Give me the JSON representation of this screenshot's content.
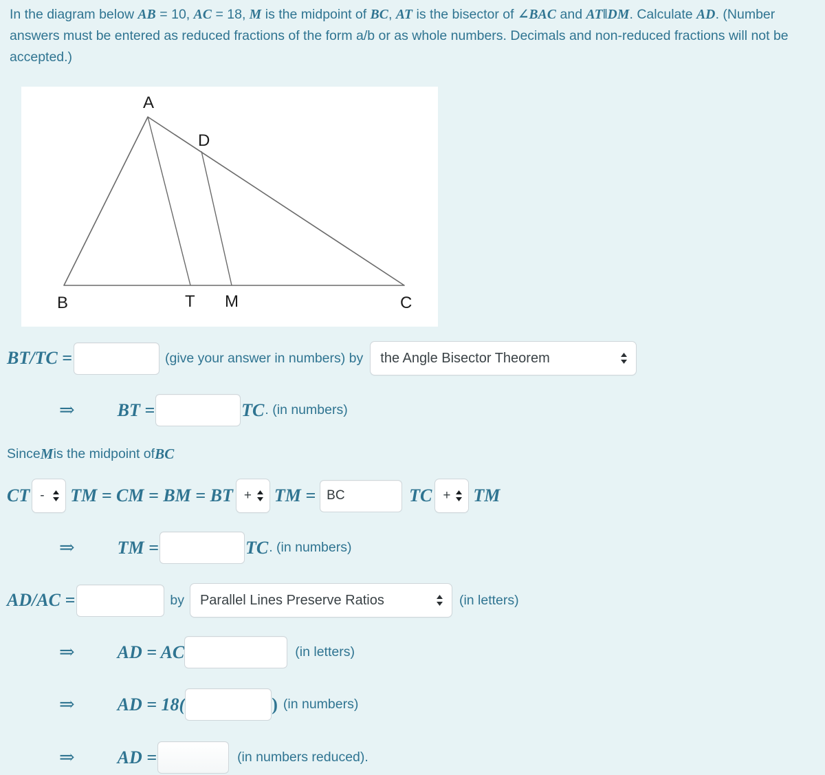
{
  "problem": {
    "line1_pre": "In the diagram below ",
    "ab": "AB",
    "ab_val": " = 10, ",
    "ac": "AC",
    "ac_val": " = 18, ",
    "m": "M",
    "mid_text": " is the midpoint of ",
    "bc": "BC",
    "comma1": ", ",
    "at": "AT",
    "bisector_text": " is the bisector of ",
    "angle_bac": "∠BAC",
    "and_text": " and ",
    "at_par_dm": "AT‖DM",
    "calc_text": ". Calculate ",
    "ad": "AD",
    "paren_text": ". (Number answers must be entered as reduced fractions of the form a/b or as whole numbers. Decimals and non-reduced fractions will not be accepted.)"
  },
  "figure": {
    "labels": {
      "A": "A",
      "B": "B",
      "C": "C",
      "D": "D",
      "T": "T",
      "M": "M"
    },
    "stroke_color": "#6a6a6a",
    "label_color": "#1a1a1a",
    "background": "#ffffff"
  },
  "row1": {
    "label": "BT/TC =",
    "input_value": "",
    "hint": "(give your answer in numbers) by",
    "select_value": "the Angle Bisector Theorem"
  },
  "row2": {
    "arrow": "⇒",
    "label": "BT =",
    "input_value": "",
    "suffix_math": "TC",
    "suffix_plain": ". (in numbers)"
  },
  "row3": {
    "since_pre": "Since ",
    "since_m": "M",
    "since_mid": " is the midpoint of ",
    "since_bc": "BC"
  },
  "row4": {
    "ct": "CT",
    "op1": "-",
    "tm1": "TM = CM = BM = BT",
    "op2": "+",
    "tm2": "TM =",
    "bc_input": "BC",
    "tc": "TC",
    "op3": "+",
    "tm3": "TM"
  },
  "row5": {
    "arrow": "⇒",
    "label": "TM =",
    "input_value": "",
    "suffix_math": "TC",
    "suffix_plain": ". (in numbers)"
  },
  "row6": {
    "label": "AD/AC =",
    "input_value": "",
    "by": "by",
    "select_value": "Parallel Lines Preserve Ratios",
    "hint": "(in letters)"
  },
  "row7": {
    "arrow": "⇒",
    "label": "AD = AC",
    "input_value": "",
    "hint": "(in letters)"
  },
  "row8": {
    "arrow": "⇒",
    "label": "AD = 18(",
    "input_value": "",
    "close": ")",
    "hint": "(in numbers)"
  },
  "row9": {
    "arrow": "⇒",
    "label": "AD =",
    "input_value": "",
    "hint": "(in numbers reduced)."
  },
  "colors": {
    "background": "#e7f3f5",
    "text": "#2f7491",
    "input_border": "#cfd6da",
    "select_text": "#3a4246"
  }
}
